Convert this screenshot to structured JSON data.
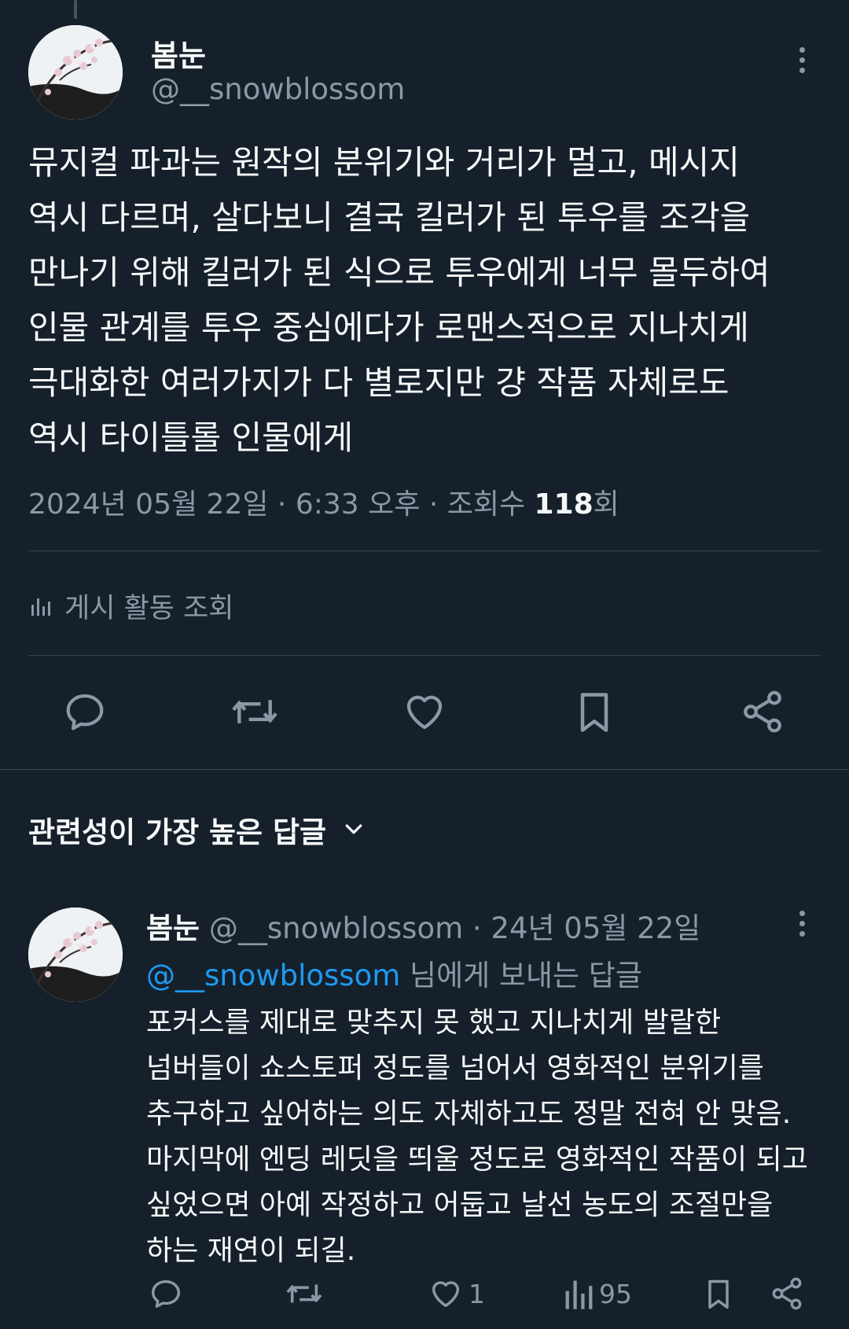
{
  "tweet": {
    "author_name": "봄눈",
    "author_handle": "@__snowblossom",
    "text": "뮤지컬 파과는 원작의 분위기와 거리가 멀고, 메시지\n역시 다르며, 살다보니 결국 킬러가 된 투우를 조각을\n만나기 위해 킬러가 된 식으로 투우에게 너무 몰두하여\n인물 관계를 투우 중심에다가 로맨스적으로 지나치게\n극대화한 여러가지가 다 별로지만 걍 작품 자체로도\n역시 타이틀롤 인물에게",
    "date": "2024년 05월 22일",
    "separator1": " · ",
    "time": "6:33 오후",
    "separator2": " · ",
    "views_prefix": "조회수 ",
    "views_count": "118",
    "views_suffix": "회",
    "activity_label": "게시 활동 조회"
  },
  "actions": {
    "icons": [
      "reply-icon",
      "retweet-icon",
      "like-icon",
      "bookmark-icon",
      "share-icon"
    ]
  },
  "replies_section": {
    "sort_label": "관련성이 가장 높은 답글"
  },
  "reply": {
    "author_name": "봄눈",
    "author_handle": "@__snowblossom",
    "date": " · 24년 05월 22일",
    "reply_to_mention": "@__snowblossom",
    "reply_to_suffix": " 님에게 보내는 답글",
    "text": "포커스를 제대로 맞추지 못 했고 지나치게 발랄한\n넘버들이 쇼스토퍼 정도를 넘어서 영화적인 분위기를\n추구하고 싶어하는 의도 자체하고도 정말 전혀 안 맞음.\n마지막에 엔딩 레딧을 띄울 정도로 영화적인 작품이 되고\n싶었으면 아예 작정하고 어둡고 날선 농도의 조절만을\n하는 재연이 되길.",
    "like_count": "1",
    "view_count": "95"
  },
  "colors": {
    "background": "#15202b",
    "text": "#f7f9f9",
    "secondary": "#8b98a5",
    "accent": "#1d9bf0",
    "divider": "#38444d"
  }
}
